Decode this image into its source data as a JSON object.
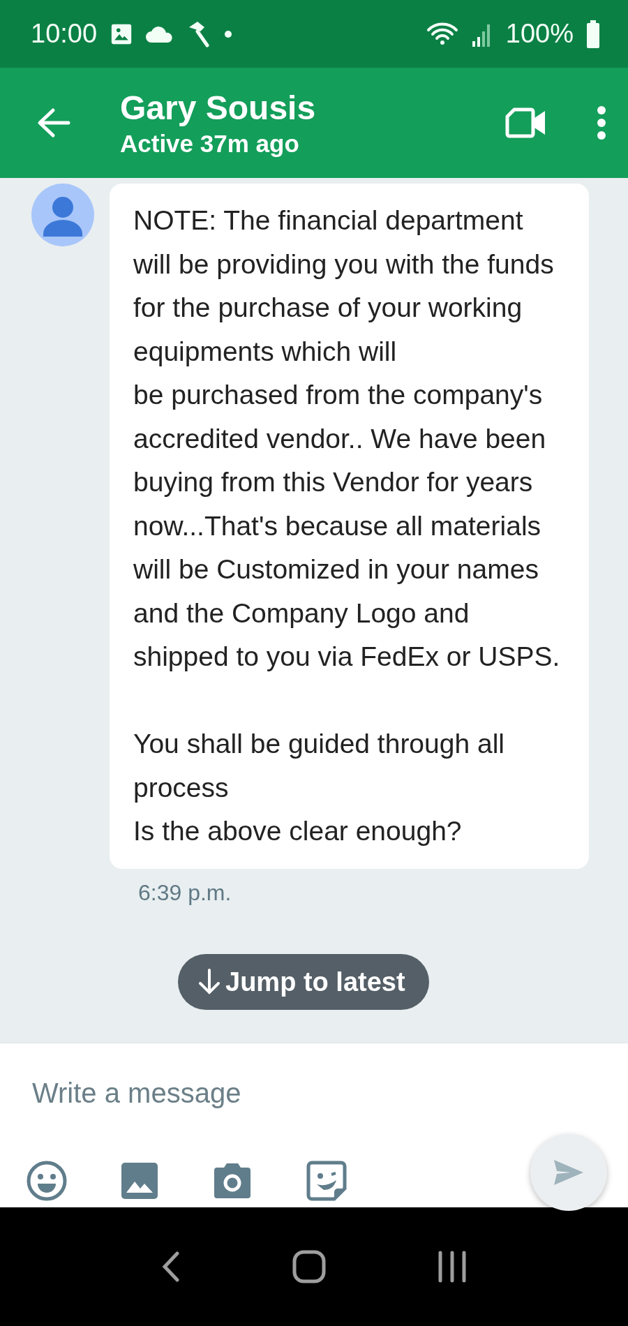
{
  "status_bar": {
    "time": "10:00",
    "battery": "100%"
  },
  "header": {
    "name": "Gary Sousis",
    "status": "Active 37m ago"
  },
  "messages": [
    {
      "text": "NOTE: The financial department will be providing you with the funds for the purchase of your working equipments which will\nbe purchased from the company's accredited vendor.. We have been buying from this Vendor for years now...That's because all materials will be Customized in your names and the Company Logo and shipped to you via FedEx or USPS.\n\nYou shall be guided through all process\nIs the above clear enough?",
      "time": "6:39 p.m."
    }
  ],
  "jump_button": {
    "label": "Jump to latest"
  },
  "composer": {
    "placeholder": "Write a message"
  }
}
